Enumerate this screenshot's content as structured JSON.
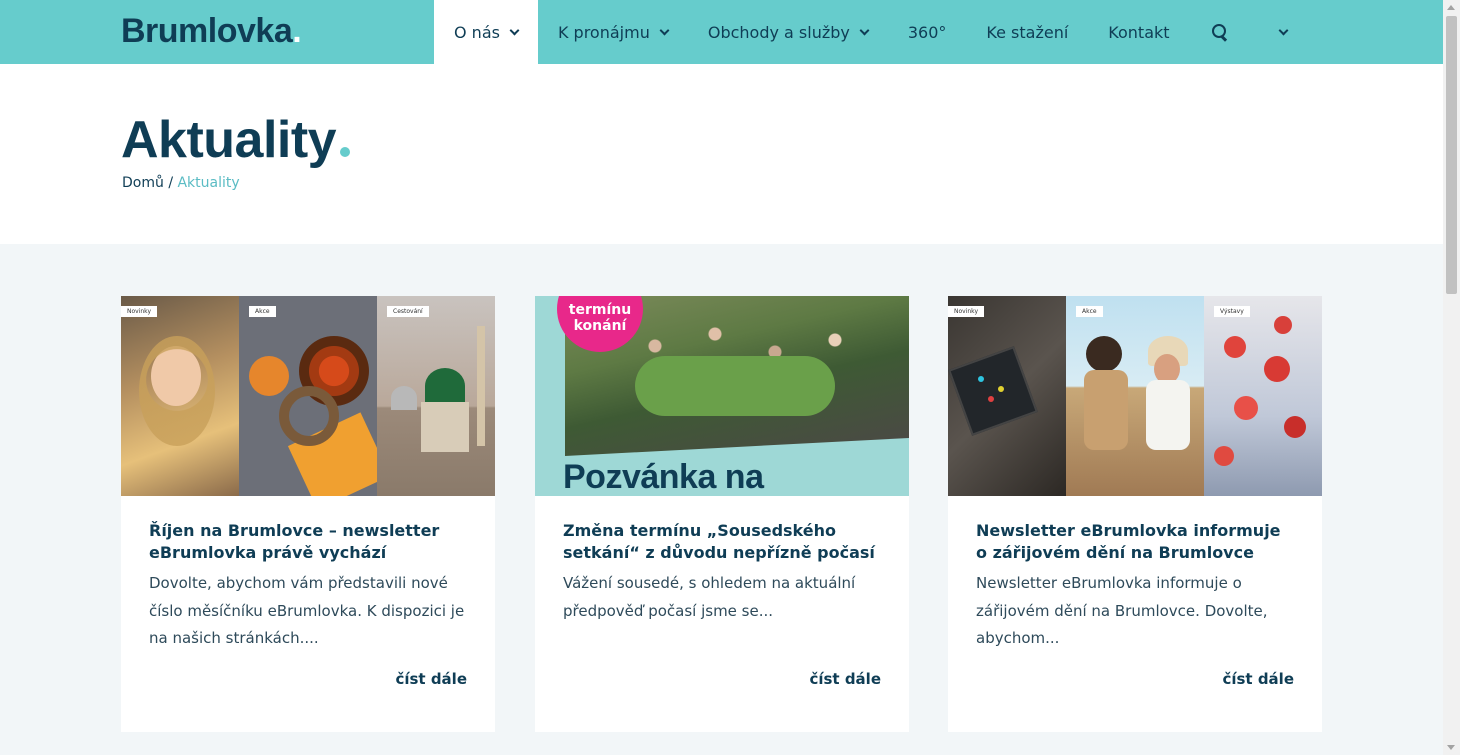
{
  "header": {
    "logo": "Brumlovka",
    "nav": [
      {
        "label": "O nás",
        "has_dropdown": true,
        "active": true
      },
      {
        "label": "K pronájmu",
        "has_dropdown": true,
        "active": false
      },
      {
        "label": "Obchody a služby",
        "has_dropdown": true,
        "active": false
      },
      {
        "label": "360°",
        "has_dropdown": false,
        "active": false
      },
      {
        "label": "Ke stažení",
        "has_dropdown": false,
        "active": false
      },
      {
        "label": "Kontakt",
        "has_dropdown": false,
        "active": false
      }
    ],
    "icons": [
      "search-icon",
      "chevron-down-icon"
    ]
  },
  "hero": {
    "title": "Aktuality",
    "breadcrumb": {
      "home": "Domů",
      "separator": "/",
      "current": "Aktuality"
    }
  },
  "cards": [
    {
      "title": "Říjen na Brumlovce – newsletter eBrumlovka právě vychází",
      "excerpt": "Dovolte, abychom vám představili nové číslo měsíčníku eBrumlovka. K dispozici je na našich stránkách....",
      "read_more": "číst dále",
      "tags": [
        "Novinky",
        "Akce",
        "Cestování"
      ]
    },
    {
      "title": "Změna termínu „Sousedského setkání“ z důvodu nepřízně počasí",
      "excerpt": "Vážení sousedé, s ohledem na aktuální předpověď počasí jsme se...",
      "read_more": "číst dále",
      "badge": "termínu konání",
      "poster_text": "Pozvánka na"
    },
    {
      "title": "Newsletter eBrumlovka informuje o zářijovém dění na Brumlovce",
      "excerpt": "Newsletter eBrumlovka informuje o zářijovém dění na Brumlovce. Dovolte, abychom...",
      "read_more": "číst dále",
      "tags": [
        "Novinky",
        "Akce",
        "Výstavy"
      ]
    }
  ],
  "colors": {
    "header_bg": "#66cccc",
    "primary_text": "#0f3d55",
    "accent": "#66cccc",
    "page_bg": "#f2f6f8",
    "badge_pink": "#e8288a"
  }
}
